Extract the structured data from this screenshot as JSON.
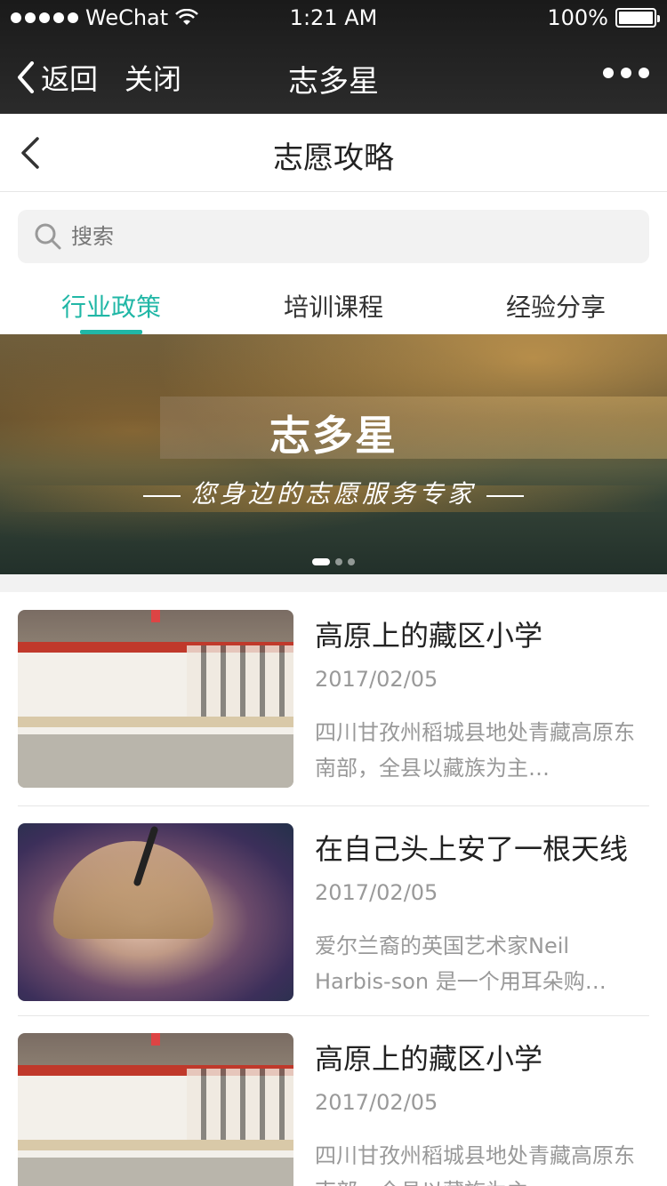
{
  "status_bar": {
    "carrier": "WeChat",
    "time": "1:21 AM",
    "battery": "100%",
    "battery_level": 1.0
  },
  "wechat_nav": {
    "back": "返回",
    "close": "关闭",
    "title": "志多星"
  },
  "page": {
    "title": "志愿攻略"
  },
  "search": {
    "placeholder": "搜索"
  },
  "tabs": [
    {
      "label": "行业政策",
      "active": true
    },
    {
      "label": "培训课程",
      "active": false
    },
    {
      "label": "经验分享",
      "active": false
    }
  ],
  "banner": {
    "title": "志多星",
    "subtitle": "您身边的志愿服务专家",
    "indicator_count": 3,
    "active_index": 0
  },
  "colors": {
    "accent": "#21b7a6",
    "wechat_bar": "#1f1f1f",
    "gray_text": "#999999"
  },
  "articles": [
    {
      "title": "高原上的藏区小学",
      "date": "2017/02/05",
      "desc": "四川甘孜州稻城县地处青藏高原东南部，全县以藏族为主…",
      "thumb": "school-image"
    },
    {
      "title": "在自己头上安了一根天线",
      "date": "2017/02/05",
      "desc": "爱尔兰裔的英国艺术家Neil Harbis-son 是一个用耳朵购…",
      "thumb": "portrait-image"
    },
    {
      "title": "高原上的藏区小学",
      "date": "2017/02/05",
      "desc": "四川甘孜州稻城县地处青藏高原东南部，全县以藏族为主…",
      "thumb": "school-image"
    }
  ]
}
